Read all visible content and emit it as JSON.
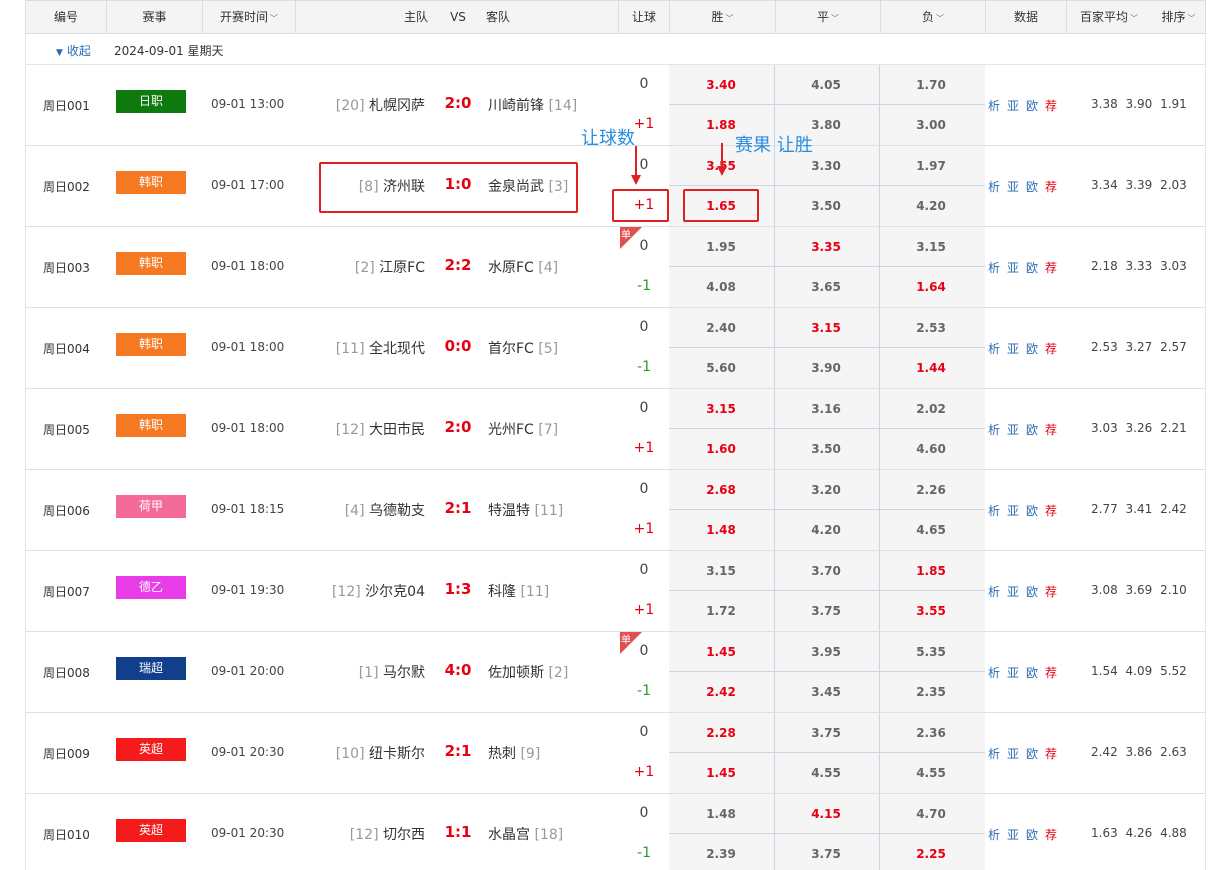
{
  "header": {
    "num": "编号",
    "league": "赛事",
    "time": "开赛时间",
    "home": "主队",
    "vs": "VS",
    "away": "客队",
    "handicap": "让球",
    "win": "胜",
    "draw": "平",
    "lose": "负",
    "data": "数据",
    "avg": "百家平均",
    "sort": "排序"
  },
  "subheader": {
    "collapse": "收起",
    "date": "2024-09-01 星期天"
  },
  "annotations": {
    "handicap_label": "让球数",
    "result_label": "赛果 让胜"
  },
  "links": [
    "析",
    "亚",
    "欧",
    "荐"
  ],
  "league_colors": {
    "日职": "#0e7a0d",
    "韩职": "#f47920",
    "荷甲": "#f46a9a",
    "德乙": "#e83ce8",
    "瑞超": "#123f8b",
    "英超": "#f51b1b"
  },
  "matches": [
    {
      "num": "周日001",
      "league": "日职",
      "time": "09-01 13:00",
      "home_rank": "[20]",
      "home": "札幌冈萨",
      "score": "2:0",
      "away": "川崎前锋",
      "away_rank": "[14]",
      "h0": "0",
      "h1": "+1",
      "single": false,
      "odds0": [
        "3.40",
        "4.05",
        "1.70"
      ],
      "odds1": [
        "1.88",
        "3.80",
        "3.00"
      ],
      "hl0": [
        true,
        false,
        false
      ],
      "hl1": [
        true,
        false,
        false
      ],
      "avg": [
        "3.38",
        "3.90",
        "1.91"
      ]
    },
    {
      "num": "周日002",
      "league": "韩职",
      "time": "09-01 17:00",
      "home_rank": "[8]",
      "home": "济州联",
      "score": "1:0",
      "away": "金泉尚武",
      "away_rank": "[3]",
      "h0": "0",
      "h1": "+1",
      "single": false,
      "odds0": [
        "3.55",
        "3.30",
        "1.97"
      ],
      "odds1": [
        "1.65",
        "3.50",
        "4.20"
      ],
      "hl0": [
        true,
        false,
        false
      ],
      "hl1": [
        true,
        false,
        false
      ],
      "avg": [
        "3.34",
        "3.39",
        "2.03"
      ]
    },
    {
      "num": "周日003",
      "league": "韩职",
      "time": "09-01 18:00",
      "home_rank": "[2]",
      "home": "江原FC",
      "score": "2:2",
      "away": "水原FC",
      "away_rank": "[4]",
      "h0": "0",
      "h1": "-1",
      "single": true,
      "odds0": [
        "1.95",
        "3.35",
        "3.15"
      ],
      "odds1": [
        "4.08",
        "3.65",
        "1.64"
      ],
      "hl0": [
        false,
        true,
        false
      ],
      "hl1": [
        false,
        false,
        true
      ],
      "avg": [
        "2.18",
        "3.33",
        "3.03"
      ]
    },
    {
      "num": "周日004",
      "league": "韩职",
      "time": "09-01 18:00",
      "home_rank": "[11]",
      "home": "全北现代",
      "score": "0:0",
      "away": "首尔FC",
      "away_rank": "[5]",
      "h0": "0",
      "h1": "-1",
      "single": false,
      "odds0": [
        "2.40",
        "3.15",
        "2.53"
      ],
      "odds1": [
        "5.60",
        "3.90",
        "1.44"
      ],
      "hl0": [
        false,
        true,
        false
      ],
      "hl1": [
        false,
        false,
        true
      ],
      "avg": [
        "2.53",
        "3.27",
        "2.57"
      ]
    },
    {
      "num": "周日005",
      "league": "韩职",
      "time": "09-01 18:00",
      "home_rank": "[12]",
      "home": "大田市民",
      "score": "2:0",
      "away": "光州FC",
      "away_rank": "[7]",
      "h0": "0",
      "h1": "+1",
      "single": false,
      "odds0": [
        "3.15",
        "3.16",
        "2.02"
      ],
      "odds1": [
        "1.60",
        "3.50",
        "4.60"
      ],
      "hl0": [
        true,
        false,
        false
      ],
      "hl1": [
        true,
        false,
        false
      ],
      "avg": [
        "3.03",
        "3.26",
        "2.21"
      ]
    },
    {
      "num": "周日006",
      "league": "荷甲",
      "time": "09-01 18:15",
      "home_rank": "[4]",
      "home": "乌德勒支",
      "score": "2:1",
      "away": "特温特",
      "away_rank": "[11]",
      "h0": "0",
      "h1": "+1",
      "single": false,
      "odds0": [
        "2.68",
        "3.20",
        "2.26"
      ],
      "odds1": [
        "1.48",
        "4.20",
        "4.65"
      ],
      "hl0": [
        true,
        false,
        false
      ],
      "hl1": [
        true,
        false,
        false
      ],
      "avg": [
        "2.77",
        "3.41",
        "2.42"
      ]
    },
    {
      "num": "周日007",
      "league": "德乙",
      "time": "09-01 19:30",
      "home_rank": "[12]",
      "home": "沙尔克04",
      "score": "1:3",
      "away": "科隆",
      "away_rank": "[11]",
      "h0": "0",
      "h1": "+1",
      "single": false,
      "odds0": [
        "3.15",
        "3.70",
        "1.85"
      ],
      "odds1": [
        "1.72",
        "3.75",
        "3.55"
      ],
      "hl0": [
        false,
        false,
        true
      ],
      "hl1": [
        false,
        false,
        true
      ],
      "avg": [
        "3.08",
        "3.69",
        "2.10"
      ]
    },
    {
      "num": "周日008",
      "league": "瑞超",
      "time": "09-01 20:00",
      "home_rank": "[1]",
      "home": "马尔默",
      "score": "4:0",
      "away": "佐加顿斯",
      "away_rank": "[2]",
      "h0": "0",
      "h1": "-1",
      "single": true,
      "odds0": [
        "1.45",
        "3.95",
        "5.35"
      ],
      "odds1": [
        "2.42",
        "3.45",
        "2.35"
      ],
      "hl0": [
        true,
        false,
        false
      ],
      "hl1": [
        true,
        false,
        false
      ],
      "avg": [
        "1.54",
        "4.09",
        "5.52"
      ]
    },
    {
      "num": "周日009",
      "league": "英超",
      "time": "09-01 20:30",
      "home_rank": "[10]",
      "home": "纽卡斯尔",
      "score": "2:1",
      "away": "热刺",
      "away_rank": "[9]",
      "h0": "0",
      "h1": "+1",
      "single": false,
      "odds0": [
        "2.28",
        "3.75",
        "2.36"
      ],
      "odds1": [
        "1.45",
        "4.55",
        "4.55"
      ],
      "hl0": [
        true,
        false,
        false
      ],
      "hl1": [
        true,
        false,
        false
      ],
      "avg": [
        "2.42",
        "3.86",
        "2.63"
      ]
    },
    {
      "num": "周日010",
      "league": "英超",
      "time": "09-01 20:30",
      "home_rank": "[12]",
      "home": "切尔西",
      "score": "1:1",
      "away": "水晶宫",
      "away_rank": "[18]",
      "h0": "0",
      "h1": "-1",
      "single": false,
      "odds0": [
        "1.48",
        "4.15",
        "4.70"
      ],
      "odds1": [
        "2.39",
        "3.75",
        "2.25"
      ],
      "hl0": [
        false,
        true,
        false
      ],
      "hl1": [
        false,
        false,
        true
      ],
      "avg": [
        "1.63",
        "4.26",
        "4.88"
      ]
    }
  ],
  "single_badge": "单"
}
